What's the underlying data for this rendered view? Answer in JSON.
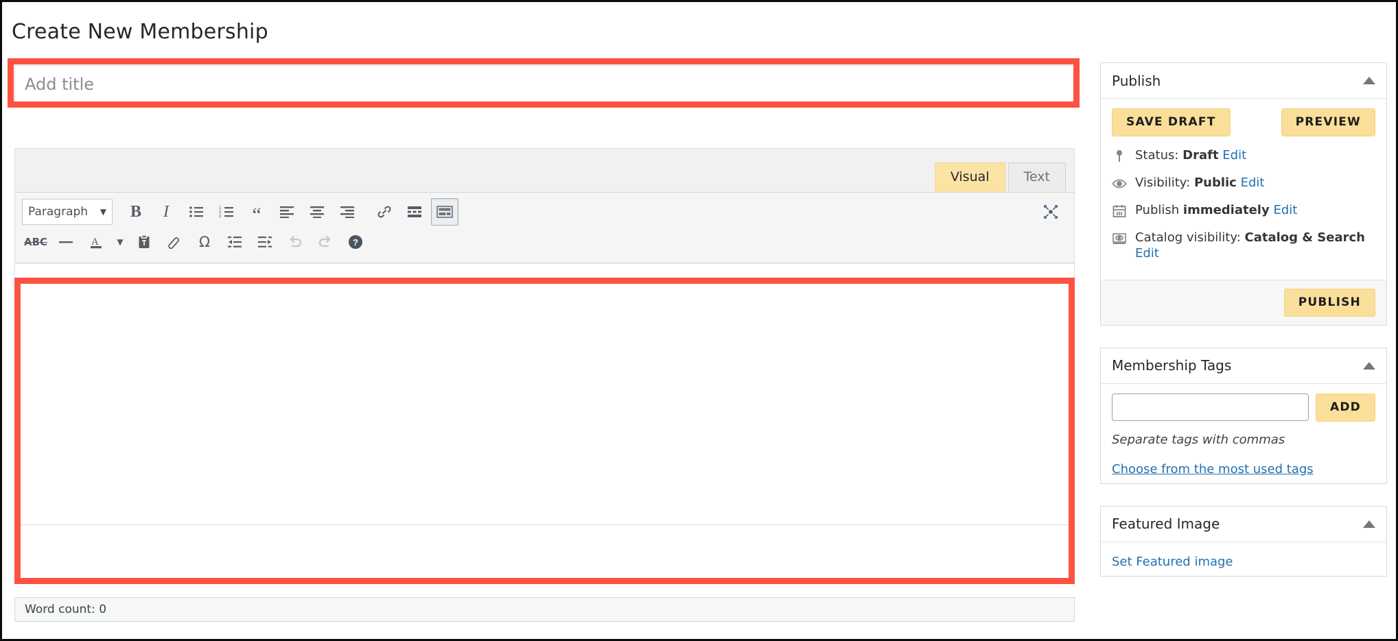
{
  "page": {
    "title": "Create New Membership"
  },
  "editor": {
    "title_placeholder": "Add title",
    "tabs": [
      {
        "label": "Visual",
        "active": true
      },
      {
        "label": "Text",
        "active": false
      }
    ],
    "format_select": "Paragraph",
    "word_count": "Word count: 0",
    "toolbar_row1": [
      "bold-icon",
      "italic-icon",
      "bulleted-list-icon",
      "numbered-list-icon",
      "blockquote-icon",
      "align-left-icon",
      "align-center-icon",
      "align-right-icon",
      "link-icon",
      "read-more-icon",
      "toolbar-toggle-icon"
    ],
    "toolbar_row2": [
      "strikethrough-icon",
      "horizontal-rule-icon",
      "text-color-icon",
      "paste-as-text-icon",
      "clear-formatting-icon",
      "special-character-icon",
      "outdent-icon",
      "indent-icon",
      "undo-icon",
      "redo-icon",
      "help-icon"
    ],
    "fullscreen_icon": "distraction-free-icon"
  },
  "sidebar": {
    "publish": {
      "title": "Publish",
      "save_draft_label": "SAVE DRAFT",
      "preview_label": "PREVIEW",
      "publish_label": "PUBLISH",
      "rows": [
        {
          "icon": "pin-icon",
          "label": "Status:",
          "value": "Draft",
          "edit": "Edit"
        },
        {
          "icon": "eye-icon",
          "label": "Visibility:",
          "value": "Public",
          "edit": "Edit"
        },
        {
          "icon": "calendar-icon",
          "label": "Publish",
          "value": "immediately",
          "edit": "Edit"
        },
        {
          "icon": "catalog-visibility-icon",
          "label": "Catalog visibility:",
          "value": "Catalog & Search",
          "edit": "Edit"
        }
      ]
    },
    "tags": {
      "title": "Membership Tags",
      "input_value": "",
      "add_label": "ADD",
      "hint": "Separate tags with commas",
      "most_used_link": "Choose from the most used tags"
    },
    "featured": {
      "title": "Featured Image",
      "set_link": "Set Featured image"
    }
  },
  "colors": {
    "accent_button": "#fadf9a",
    "active_tab": "#fbe3a4",
    "link": "#2271b1",
    "annotation": "#fb5343"
  }
}
